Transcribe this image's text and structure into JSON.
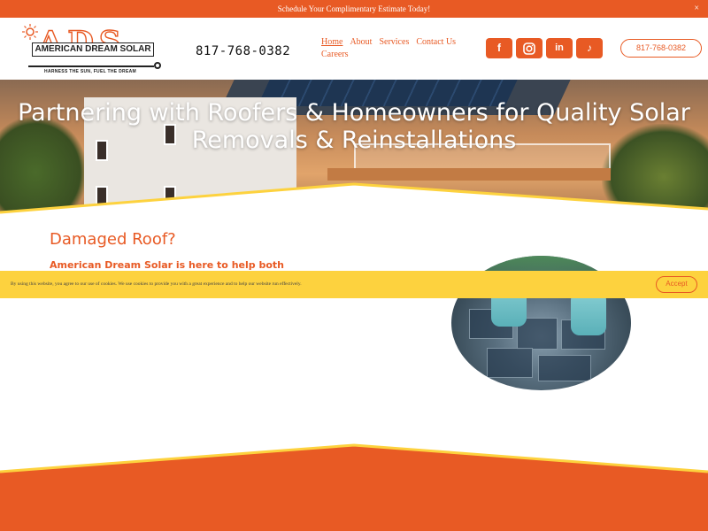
{
  "promo": {
    "text": "Schedule Your Complimentary Estimate Today!",
    "close": "×"
  },
  "logo": {
    "letters": "ADS",
    "name": "AMERICAN DREAM SOLAR",
    "tagline": "HARNESS THE SUN, FUEL THE DREAM",
    "icon": "sun-icon"
  },
  "header": {
    "phone": "817-768-0382"
  },
  "nav": {
    "items": [
      {
        "label": "Home"
      },
      {
        "label": "About"
      },
      {
        "label": "Services"
      },
      {
        "label": "Contact Us"
      },
      {
        "label": "Careers"
      }
    ]
  },
  "social": [
    {
      "icon": "facebook-icon",
      "glyph": "f"
    },
    {
      "icon": "instagram-icon",
      "glyph": "◎"
    },
    {
      "icon": "linkedin-icon",
      "glyph": "in"
    },
    {
      "icon": "tiktok-icon",
      "glyph": "♪"
    }
  ],
  "phone_button": {
    "label": "817-768-0382"
  },
  "hero": {
    "title": "Partnering with Roofers & Homeowners for Quality Solar Removals & Reinstallations"
  },
  "content": {
    "title": "Damaged Roof?",
    "subtitle": "American Dream Solar is here to help both"
  },
  "cookie": {
    "text": "By using this website, you agree to our use of cookies. We use cookies to provide you with a great experience and to help our website run effectively.",
    "accept": "Accept"
  },
  "colors": {
    "brand": "#e85a24",
    "accent_yellow": "#fdd23e",
    "text_dark": "#111111"
  }
}
